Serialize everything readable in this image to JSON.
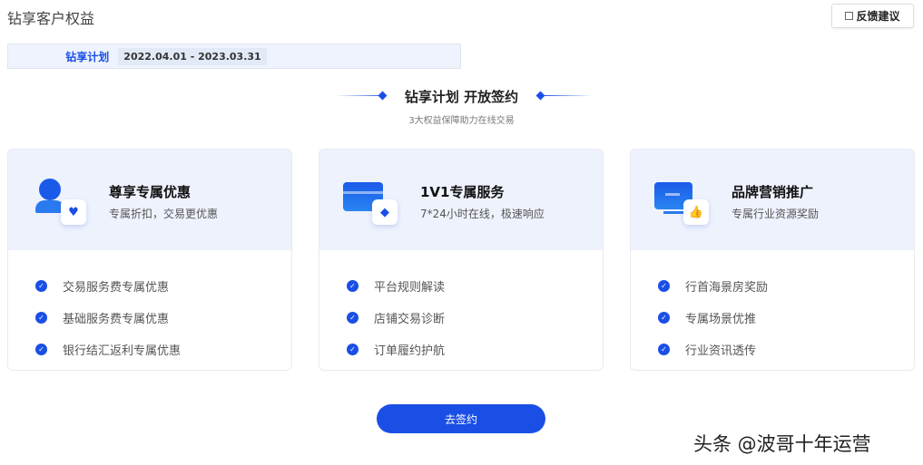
{
  "page": {
    "title": "钻享客户权益",
    "feedback_label": "反馈建议"
  },
  "plan": {
    "label": "钻享计划",
    "period": "2022.04.01 - 2023.03.31"
  },
  "section": {
    "heading": "钻享计划 开放签约",
    "subheading": "3大权益保障助力在线交易"
  },
  "cards": [
    {
      "title": "尊享专属优惠",
      "subtitle": "专属折扣，交易更优惠",
      "icon": "user-heart-icon",
      "items": [
        "交易服务费专属优惠",
        "基础服务费专属优惠",
        "银行结汇返利专属优惠"
      ]
    },
    {
      "title": "1V1专属服务",
      "subtitle": "7*24小时在线，极速响应",
      "icon": "card-diamond-icon",
      "items": [
        "平台规则解读",
        "店铺交易诊断",
        "订单履约护航"
      ]
    },
    {
      "title": "品牌营销推广",
      "subtitle": "专属行业资源奖励",
      "icon": "monitor-thumbsup-icon",
      "items": [
        "行首海景房奖励",
        "专属场景优推",
        "行业资讯透传"
      ]
    }
  ],
  "cta": {
    "label": "去签约"
  },
  "watermark": "头条 @波哥十年运营",
  "colors": {
    "accent": "#1a4fe6",
    "card_header_bg": "#eef2fd"
  }
}
